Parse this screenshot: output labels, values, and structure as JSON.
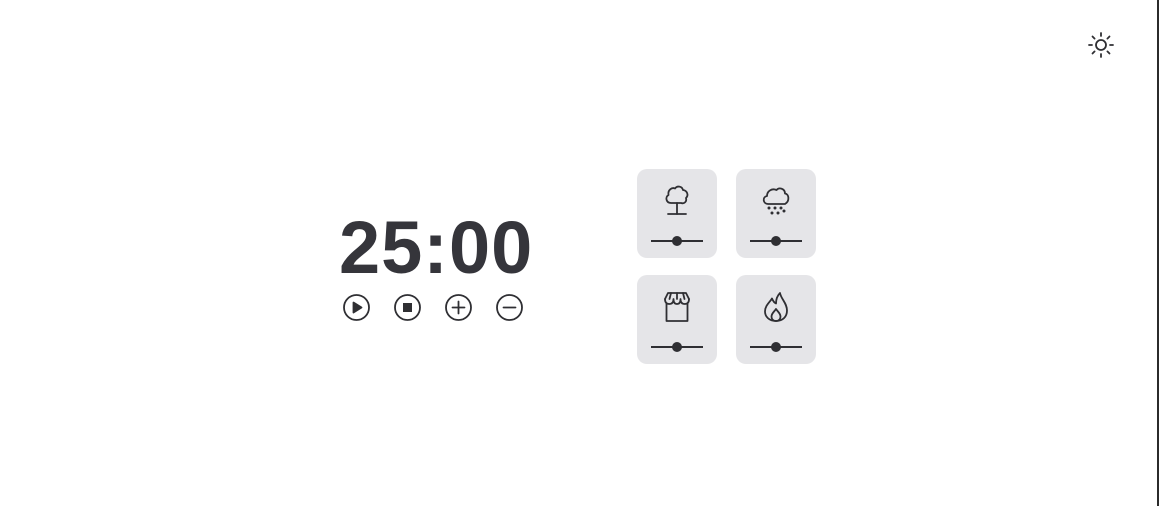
{
  "theme_toggle": {
    "icon": "sun-icon"
  },
  "timer": {
    "display": "25:00",
    "controls": [
      {
        "name": "play-button",
        "icon": "play-icon"
      },
      {
        "name": "stop-button",
        "icon": "stop-icon"
      },
      {
        "name": "increase-button",
        "icon": "plus-icon"
      },
      {
        "name": "decrease-button",
        "icon": "minus-icon"
      }
    ]
  },
  "sounds": [
    {
      "name": "forest",
      "icon": "tree-icon",
      "volume": 0.5
    },
    {
      "name": "rain",
      "icon": "cloud-rain-icon",
      "volume": 0.5
    },
    {
      "name": "coffee-shop",
      "icon": "storefront-icon",
      "volume": 0.5
    },
    {
      "name": "fireplace",
      "icon": "flame-icon",
      "volume": 0.5
    }
  ],
  "colors": {
    "text": "#35353b",
    "icon": "#2f2f33",
    "card_background": "#e5e5e8",
    "page_background": "#ffffff"
  }
}
